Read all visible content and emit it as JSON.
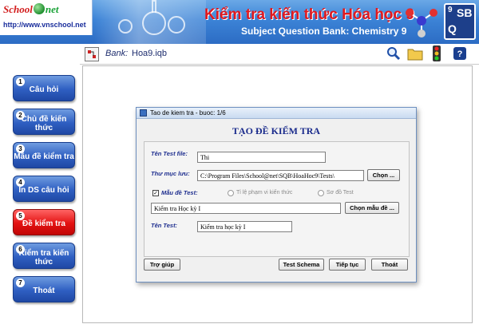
{
  "header": {
    "logo_school": "School",
    "logo_net": "net",
    "logo_url": "http://www.vnschool.net",
    "title_vi": "Kiểm tra kiến thức Hóa học 9",
    "title_en": "Subject Question Bank: Chemistry 9",
    "badge_number": "9",
    "badge_letters": "SB",
    "badge_q": "Q"
  },
  "toolbar": {
    "bank_label": "Bank:",
    "bank_value": "Hoa9.iqb",
    "icons": [
      "search-icon",
      "folder-icon",
      "traffic-light-icon",
      "help-icon"
    ]
  },
  "sidebar": {
    "items": [
      {
        "num": "1",
        "label": "Câu hỏi"
      },
      {
        "num": "2",
        "label": "Chủ đề kiến thức"
      },
      {
        "num": "3",
        "label": "Mẫu đề kiểm tra"
      },
      {
        "num": "4",
        "label": "In DS câu hỏi"
      },
      {
        "num": "5",
        "label": "Đề kiểm tra"
      },
      {
        "num": "6",
        "label": "Kiểm tra kiến thức"
      },
      {
        "num": "7",
        "label": "Thoát"
      }
    ],
    "active_index": 4
  },
  "dialog": {
    "title": "Tao de kiem tra - buoc: 1/6",
    "heading": "TẠO ĐỀ KIỂM TRA",
    "test_file_label": "Tên Test file:",
    "test_file_value": "Thi",
    "folder_label": "Thư mục lưu:",
    "folder_value": "C:\\Program Files\\School@net\\SQB\\HoaHoc9\\Tests\\",
    "folder_button": "Chọn ...",
    "template_checkbox_label": "Mẫu đề Test:",
    "template_checked": true,
    "radio_ratio_label": "Tỉ lệ phạm vi kiến thức",
    "radio_diagram_label": "Sơ đồ Test",
    "template_value": "Kiểm tra Học kỳ I",
    "template_button": "Chọn mẫu đề ...",
    "test_name_label": "Tên Test:",
    "test_name_value": "Kiểm tra học kỳ I",
    "btn_help": "Trợ giúp",
    "btn_schema": "Test Schema",
    "btn_next": "Tiếp tục",
    "btn_exit": "Thoát"
  }
}
